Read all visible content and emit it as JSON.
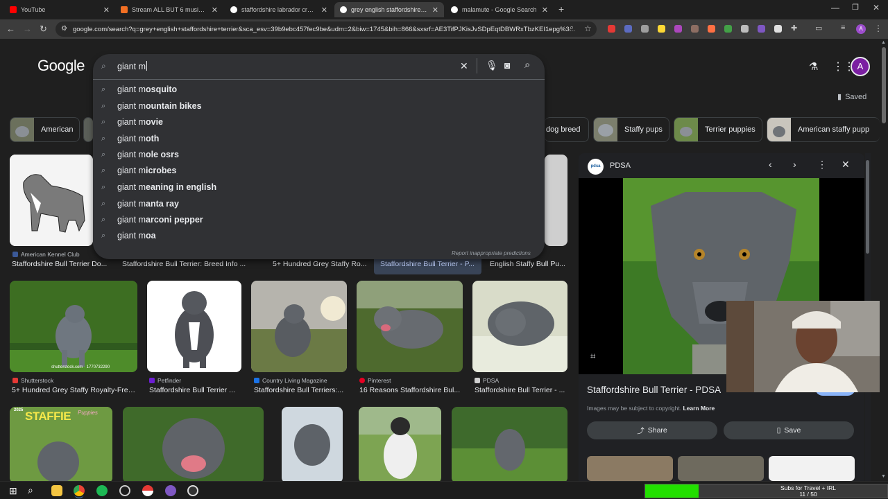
{
  "browser": {
    "tabs": [
      {
        "title": "YouTube",
        "favicon_color": "#ff0000"
      },
      {
        "title": "Stream ALL BUT 6 music | Li",
        "favicon_color": "#f26f23"
      },
      {
        "title": "staffordshire labrador cross - G",
        "favicon_color": "#4285f4"
      },
      {
        "title": "grey english staffordshire terri",
        "favicon_color": "#4285f4"
      },
      {
        "title": "malamute - Google Search",
        "favicon_color": "#4285f4"
      }
    ],
    "new_tab": "+",
    "url": "google.com/search?q=grey+english+staffordshire+terrier&sca_esv=39b9ebc457fec9be&udm=2&biw=1745&bih=866&sxsrf=AE3TifPJKisJvSDpEqtDBWRxTbzKEI1epg%3...",
    "profile_initial": "A"
  },
  "google": {
    "logo": "Google",
    "search": {
      "typed": "giant m",
      "suggestions": [
        {
          "prefix": "giant m",
          "bold": "osquito"
        },
        {
          "prefix": "giant m",
          "bold": "ountain bikes"
        },
        {
          "prefix": "giant m",
          "bold": "ovie"
        },
        {
          "prefix": "giant m",
          "bold": "oth"
        },
        {
          "prefix": "giant m",
          "bold": "ole osrs"
        },
        {
          "prefix": "giant m",
          "bold": "icrobes"
        },
        {
          "prefix": "giant m",
          "bold": "eaning in english"
        },
        {
          "prefix": "giant m",
          "bold": "anta ray"
        },
        {
          "prefix": "giant m",
          "bold": "arconi pepper"
        },
        {
          "prefix": "giant m",
          "bold": "oa"
        }
      ],
      "report": "Report inappropriate predictions"
    },
    "saved": "Saved",
    "avatar_initial": "A",
    "chips": [
      "American",
      "dog breed",
      "Staffy pups",
      "Terrier puppies",
      "American staffy pupp"
    ],
    "row1": [
      {
        "source": "American Kennel Club",
        "caption": "Staffordshire Bull Terrier Do..."
      },
      {
        "source": "",
        "caption": "Staffordshire Bull Terrier: Breed Info ..."
      },
      {
        "source": "",
        "caption": "5+ Hundred Grey Staffy Ro..."
      },
      {
        "source": "",
        "caption": "Staffordshire Bull Terrier - P..."
      },
      {
        "source": "",
        "caption": "English Staffy Bull Pu..."
      }
    ],
    "row2": [
      {
        "source": "Shutterstock",
        "caption": "5+ Hundred Grey Staffy Royalty-Free..."
      },
      {
        "source": "Petfinder",
        "caption": "Staffordshire Bull Terrier ..."
      },
      {
        "source": "Country Living Magazine",
        "caption": "Staffordshire Bull Terriers:..."
      },
      {
        "source": "Pinterest",
        "caption": "16 Reasons Staffordshire Bul..."
      },
      {
        "source": "PDSA",
        "caption": "Staffordshire Bull Terrier - ..."
      }
    ],
    "shutter_watermark": "shutterstock.com · 1770732290",
    "staffie_banner": "STAFFIE",
    "staffie_sub": "Puppies",
    "staffie_year": "2025",
    "panel": {
      "source": "PDSA",
      "source_logo": "pdsa",
      "title": "Staffordshire Bull Terrier - PDSA",
      "copyright": "Images may be subject to copyright.",
      "learn_more": "Learn More",
      "visit": "Visit",
      "share": "Share",
      "save": "Save"
    }
  },
  "overlay": {
    "subs_label": "Subs for Travel + IRL",
    "subs_count": "11 / 50",
    "subs_progress": 0.22
  }
}
